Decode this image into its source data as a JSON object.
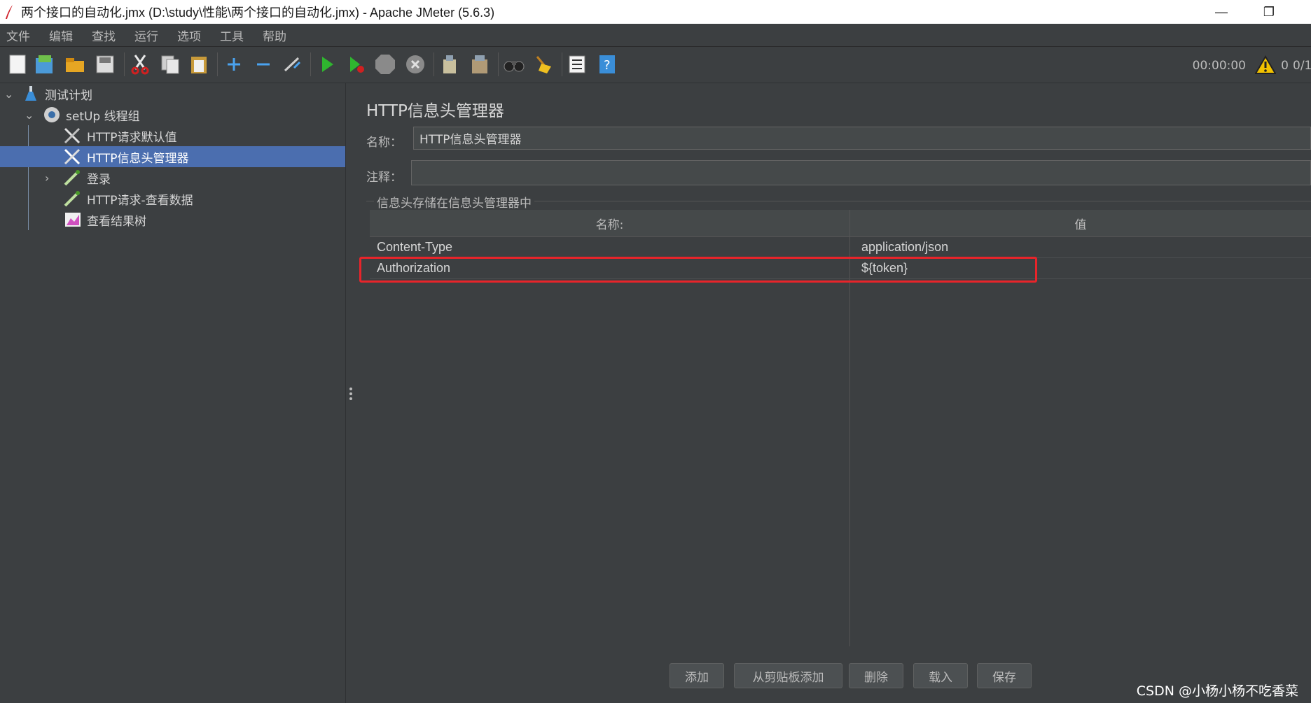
{
  "window": {
    "title": "两个接口的自动化.jmx (D:\\study\\性能\\两个接口的自动化.jmx) - Apache JMeter (5.6.3)",
    "minimize_glyph": "—",
    "restore_glyph": "❐"
  },
  "menu": [
    "文件",
    "编辑",
    "查找",
    "运行",
    "选项",
    "工具",
    "帮助"
  ],
  "status": {
    "timer": "00:00:00",
    "warnings": "0",
    "threads": "0/1"
  },
  "tree": {
    "items": [
      {
        "label": "测试计划"
      },
      {
        "label": "setUp 线程组"
      },
      {
        "label": "HTTP请求默认值"
      },
      {
        "label": "HTTP信息头管理器"
      },
      {
        "label": "登录"
      },
      {
        "label": "HTTP请求-查看数据"
      },
      {
        "label": "查看结果树"
      }
    ]
  },
  "panel": {
    "heading": "HTTP信息头管理器",
    "name_label": "名称：",
    "name_value": "HTTP信息头管理器",
    "comment_label": "注释：",
    "comment_value": "",
    "group_title": "信息头存储在信息头管理器中",
    "columns": [
      "名称:",
      "值"
    ],
    "rows": [
      {
        "name": "Content-Type",
        "value": "application/json"
      },
      {
        "name": "Authorization",
        "value": "${token}"
      }
    ]
  },
  "buttons": {
    "add": "添加",
    "add_clipboard": "从剪贴板添加",
    "delete": "删除",
    "load": "载入",
    "save": "保存"
  },
  "watermark": "CSDN @小杨小杨不吃香菜",
  "colors": {
    "background": "#3c3f41",
    "selection": "#4b6eaf",
    "highlight_box": "#e8242a"
  }
}
